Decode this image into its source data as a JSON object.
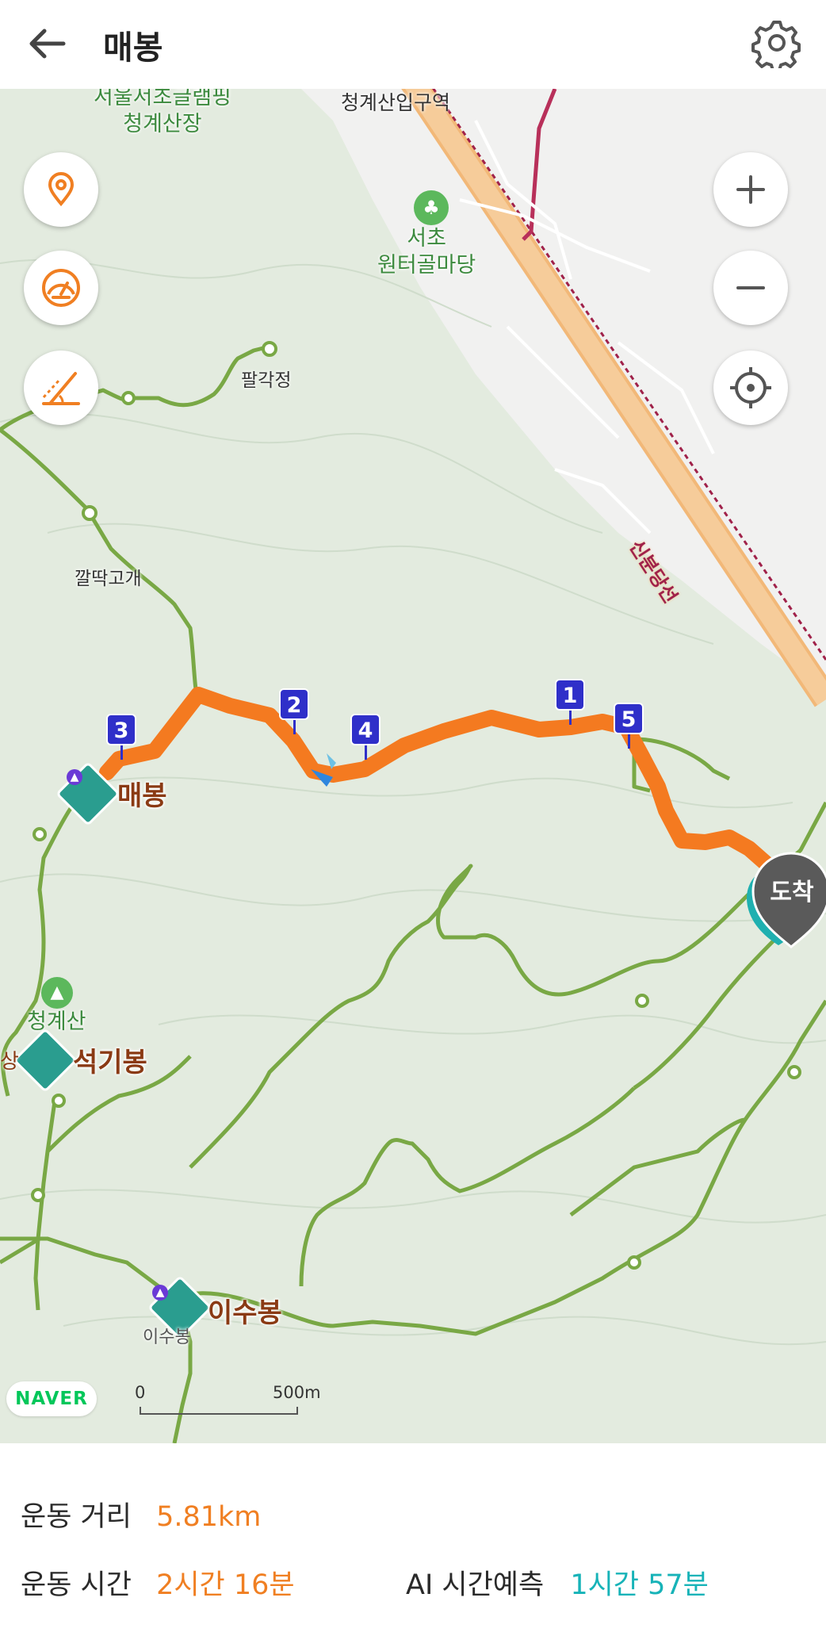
{
  "header": {
    "title": "매봉",
    "back_icon": "arrow-left-icon",
    "settings_icon": "gear-icon"
  },
  "map_controls": {
    "left": [
      {
        "name": "location-pin-button",
        "icon": "location-pin-icon"
      },
      {
        "name": "speedometer-button",
        "icon": "speedometer-icon"
      },
      {
        "name": "elevation-button",
        "icon": "elevation-slope-icon"
      }
    ],
    "right": [
      {
        "name": "zoom-in-button",
        "icon": "plus-icon"
      },
      {
        "name": "zoom-out-button",
        "icon": "minus-icon"
      },
      {
        "name": "my-location-button",
        "icon": "crosshair-icon"
      }
    ]
  },
  "map": {
    "labels": {
      "top_campsite": "서울서초글램핑\n청계산장",
      "top_station": "청계산입구역",
      "garden": "서초\n원터골마당",
      "palgakjeong": "팔각정",
      "kkalttak": "깔딱고개",
      "maebong": "매봉",
      "cheonggyesan": "청계산",
      "seokgibong": "석기봉",
      "isubong": "이수봉",
      "isubong_small": "이수봉",
      "rail_line": "신분당선",
      "edge_partial": "상"
    },
    "route_markers": [
      "1",
      "2",
      "3",
      "4",
      "5"
    ],
    "arrival_pin": "도착",
    "provider_logo": "NAVER",
    "scale": {
      "start": "0",
      "end": "500m"
    },
    "colors": {
      "route": "#f47a20",
      "trail": "#79a845",
      "marker": "#2f2fc9",
      "peak": "#2a9d8f",
      "arrival": "#555555"
    }
  },
  "stats": {
    "distance_label": "운동 거리",
    "distance_value": "5.81km",
    "time_label": "운동 시간",
    "time_value": "2시간 16분",
    "ai_label": "AI 시간예측",
    "ai_value": "1시간 57분"
  }
}
